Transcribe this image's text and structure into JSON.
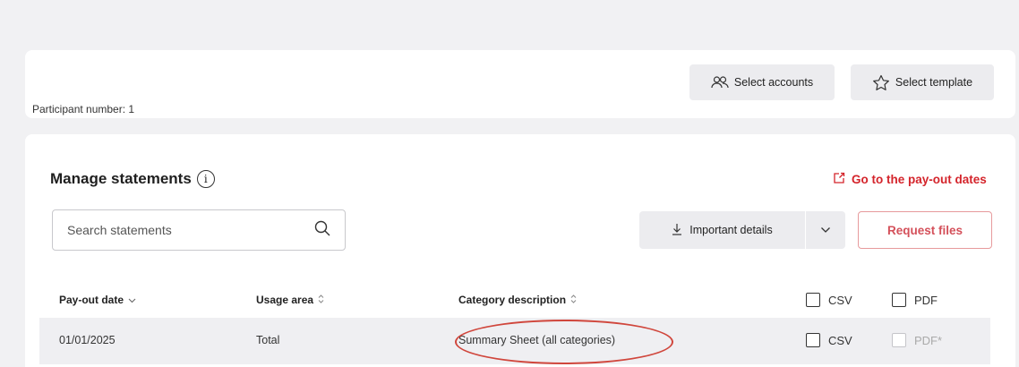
{
  "header": {
    "participant_label": "Participant number: 1",
    "select_accounts_label": "Select accounts",
    "select_template_label": "Select template"
  },
  "statements": {
    "title": "Manage statements",
    "goto_link_label": "Go to the pay-out dates",
    "search_placeholder": "Search statements",
    "important_details_label": "Important details",
    "request_files_label": "Request files"
  },
  "table": {
    "columns": {
      "payout_date": "Pay-out date",
      "usage_area": "Usage area",
      "category_description": "Category description",
      "csv": "CSV",
      "pdf": "PDF"
    },
    "rows": [
      {
        "payout_date": "01/01/2025",
        "usage_area": "Total",
        "category_description": "Summary Sheet (all categories)",
        "csv": "CSV",
        "pdf": "PDF*"
      }
    ]
  },
  "colors": {
    "accent_red": "#d4242b",
    "button_gray": "#ececef",
    "row_bg": "#efeff2",
    "page_bg": "#f1f1f3"
  },
  "icons": {
    "accounts": "people-icon",
    "template": "star-icon",
    "info": "info-icon",
    "external_link": "external-link-icon",
    "search": "search-icon",
    "download": "download-icon",
    "chevron": "chevron-down-icon",
    "sort": "sort-icon"
  }
}
